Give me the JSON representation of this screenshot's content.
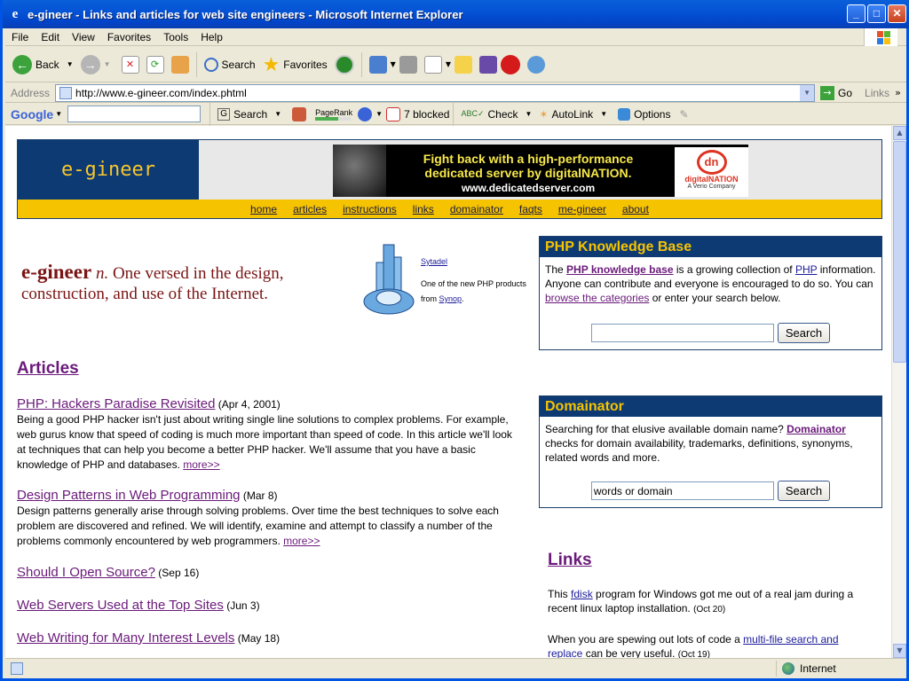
{
  "window": {
    "title": "e-gineer - Links and articles for web site engineers - Microsoft Internet Explorer"
  },
  "menu": [
    "File",
    "Edit",
    "View",
    "Favorites",
    "Tools",
    "Help"
  ],
  "toolbar": {
    "back": "Back",
    "search": "Search",
    "favorites": "Favorites"
  },
  "address": {
    "label": "Address",
    "url": "http://www.e-gineer.com/index.phtml",
    "go": "Go",
    "links": "Links"
  },
  "googlebar": {
    "search": "Search",
    "pagerank": "PageRank",
    "blocked": "7 blocked",
    "check": "Check",
    "autolink": "AutoLink",
    "options": "Options"
  },
  "site": {
    "logo": "e-gineer",
    "banner": {
      "line1": "Fight back with a high-performance",
      "line2": "dedicated server by digitalNATION.",
      "line3": "www.dedicatedserver.com",
      "brand": "digitalNATION",
      "brand_sub": "A Verio Company"
    },
    "nav": [
      "home",
      "articles",
      "instructions",
      "links",
      "domainator",
      "faqts",
      "me-gineer",
      "about"
    ],
    "slogan": {
      "word": "e-gineer",
      "pos": "n.",
      "def": "One versed in the design, construction, and use of the Internet."
    },
    "promo": {
      "name": "Sytadel",
      "text": "One of the new PHP products from",
      "link": "Synop",
      "end": "."
    },
    "articles_heading": "Articles",
    "articles": [
      {
        "title": "PHP: Hackers Paradise Revisited",
        "date": "(Apr 4, 2001)",
        "body": "Being a good PHP hacker isn't just about writing single line solutions to complex problems. For example, web gurus know that speed of coding is much more important than speed of code. In this article we'll look at techniques that can help you become a better PHP hacker. We'll assume that you have a basic knowledge of PHP and databases.",
        "more": "more>>"
      },
      {
        "title": "Design Patterns in Web Programming",
        "date": "(Mar 8)",
        "body": "Design patterns generally arise through solving problems. Over time the best techniques to solve each problem are discovered and refined. We will identify, examine and attempt to classify a number of the problems commonly encountered by web programmers.",
        "more": "more>>"
      },
      {
        "title": "Should I Open Source?",
        "date": "(Sep 16)"
      },
      {
        "title": "Web Servers Used at the Top Sites",
        "date": "(Jun 3)"
      },
      {
        "title": "Web Writing for Many Interest Levels",
        "date": "(May 18)"
      }
    ],
    "kb": {
      "heading": "PHP Knowledge Base",
      "t1": "The",
      "l1": "PHP knowledge base",
      "t2": "is a growing collection of",
      "l2": "PHP",
      "t3": "information. Anyone can contribute and everyone is encouraged to do so. You can",
      "l3": "browse the categories",
      "t4": "or enter your search below.",
      "input": "",
      "button": "Search"
    },
    "dom": {
      "heading": "Domainator",
      "t1": "Searching for that elusive available domain name?",
      "l1": "Domainator",
      "t2": "checks for domain availability, trademarks, definitions, synonyms, related words and more.",
      "input": "words or domain",
      "button": "Search"
    },
    "links_heading": "Links",
    "links": [
      {
        "t1": "This",
        "link": "fdisk",
        "t2": "program for Windows got me out of a real jam during a recent linux laptop installation.",
        "date": "(Oct 20)"
      },
      {
        "t1": "When you are spewing out lots of code a",
        "link": "multi-file search and replace",
        "t2": "can be very useful.",
        "date": "(Oct 19)"
      }
    ]
  },
  "status": {
    "zone": "Internet"
  }
}
